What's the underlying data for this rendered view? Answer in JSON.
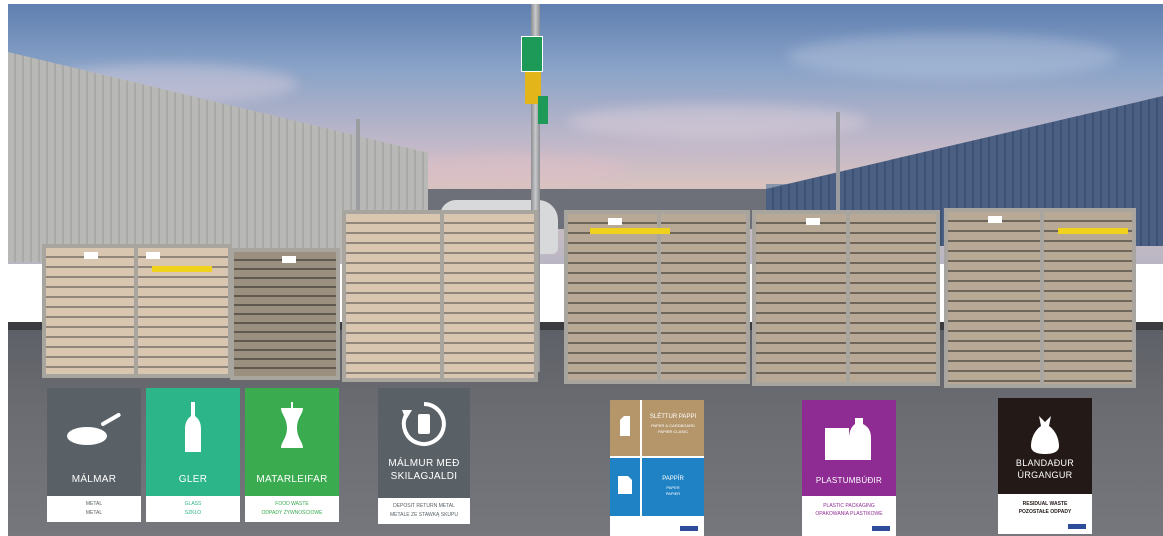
{
  "scene": {
    "description_colors": {
      "sky_top": "#5f7fb0",
      "ground": "#6a6c72",
      "wood": "#d9c6b0"
    }
  },
  "signs": [
    {
      "id": "malmar",
      "title": "MÁLMAR",
      "line1": "METAL",
      "line2": "METAL",
      "color": "#5a6166",
      "icon": "frying-pan-icon"
    },
    {
      "id": "gler",
      "title": "GLER",
      "line1": "GLASS",
      "line2": "SZKŁO",
      "color": "#2db58a",
      "text_color": "#2db58a",
      "icon": "bottle-icon"
    },
    {
      "id": "matarleifar",
      "title": "MATARLEIFAR",
      "line1": "FOOD WASTE",
      "line2": "ODPADY ŻYWNOŚCIOWE",
      "color": "#3aab4f",
      "text_color": "#3aab4f",
      "icon": "apple-core-icon"
    },
    {
      "id": "malmur-skilagjaldi",
      "title_line1": "MÁLMUR MEÐ",
      "title_line2": "SKILAGJALDI",
      "line1": "DEPOSIT RETURN METAL",
      "line2": "METALE ZE STAWKĄ SKUPU",
      "color": "#5a6166",
      "icon": "can-return-icon"
    },
    {
      "id": "pappi-pappir",
      "top_title": "SLÉTTUR PAPPI",
      "top_line1": "PAPER & CARDBOARD",
      "top_line2": "PAPIER CLASIC",
      "bottom_title": "PAPPÍR",
      "bottom_line1": "PAPER",
      "bottom_line2": "PAPIER",
      "top_color": "#b5966a",
      "bottom_color": "#1e82c4",
      "icon_top": "carton-icon",
      "icon_bottom": "paper-sheet-icon"
    },
    {
      "id": "plastumbudir",
      "title": "PLASTUMBÚÐIR",
      "line1": "PLASTIC PACKAGING",
      "line2": "OPAKOWANIA PLASTIKOWE",
      "color": "#8e2c93",
      "text_color": "#8e2c93",
      "icon": "plastic-bottle-icon"
    },
    {
      "id": "blandadur",
      "title_line1": "BLANDAÐUR",
      "title_line2": "ÚRGANGUR",
      "line1": "RESIDUAL WASTE",
      "line2": "POZOSTAŁE ODPADY",
      "color": "#231916",
      "text_color": "#231916",
      "icon": "trash-bag-icon"
    }
  ]
}
